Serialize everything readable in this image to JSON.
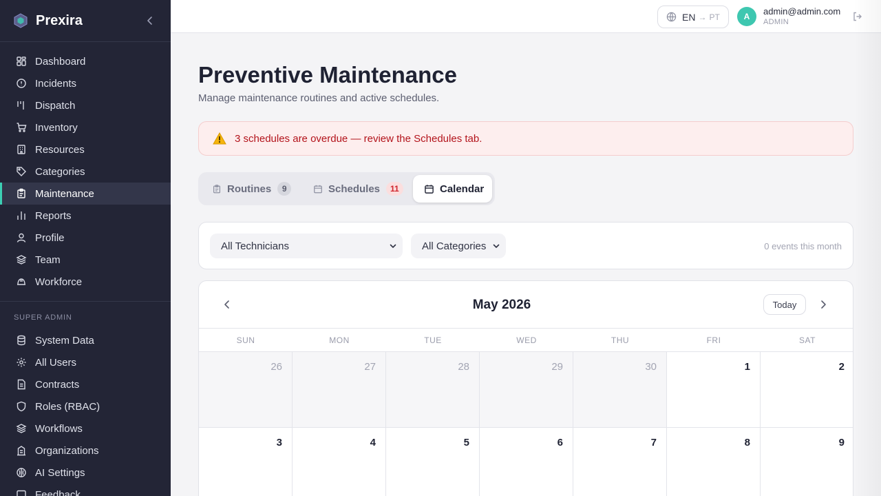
{
  "brand": {
    "name": "Prexira"
  },
  "sidebar": {
    "items": [
      {
        "label": "Dashboard",
        "icon": "dashboard-icon",
        "active": false
      },
      {
        "label": "Incidents",
        "icon": "alert-circle-icon",
        "active": false
      },
      {
        "label": "Dispatch",
        "icon": "dispatch-icon",
        "active": false
      },
      {
        "label": "Inventory",
        "icon": "cart-icon",
        "active": false
      },
      {
        "label": "Resources",
        "icon": "building-icon",
        "active": false
      },
      {
        "label": "Categories",
        "icon": "tag-icon",
        "active": false
      },
      {
        "label": "Maintenance",
        "icon": "clipboard-icon",
        "active": true
      },
      {
        "label": "Reports",
        "icon": "bar-chart-icon",
        "active": false
      },
      {
        "label": "Profile",
        "icon": "user-icon",
        "active": false
      },
      {
        "label": "Team",
        "icon": "layers-icon",
        "active": false
      },
      {
        "label": "Workforce",
        "icon": "hard-hat-icon",
        "active": false
      }
    ],
    "admin_section_label": "SUPER ADMIN",
    "admin_items": [
      {
        "label": "System Data",
        "icon": "database-icon"
      },
      {
        "label": "All Users",
        "icon": "gear-icon"
      },
      {
        "label": "Contracts",
        "icon": "document-icon"
      },
      {
        "label": "Roles (RBAC)",
        "icon": "shield-icon"
      },
      {
        "label": "Workflows",
        "icon": "layers-icon"
      },
      {
        "label": "Organizations",
        "icon": "building-icon"
      },
      {
        "label": "AI Settings",
        "icon": "brain-icon"
      },
      {
        "label": "Feedback",
        "icon": "message-icon"
      }
    ]
  },
  "topbar": {
    "lang_current": "EN",
    "lang_arrow": "→",
    "lang_other": "PT",
    "avatar_letter": "A",
    "user_email": "admin@admin.com",
    "user_role": "ADMIN"
  },
  "page": {
    "title": "Preventive Maintenance",
    "subtitle": "Manage maintenance routines and active schedules.",
    "alert": "3 schedules are overdue — review the Schedules tab."
  },
  "tabs": {
    "routines_label": "Routines",
    "routines_count": "9",
    "schedules_label": "Schedules",
    "schedules_count": "11",
    "calendar_label": "Calendar",
    "active": "Calendar"
  },
  "filters": {
    "technicians": "All Technicians",
    "categories": "All Categories",
    "events_text": "0 events this month"
  },
  "calendar": {
    "month_label": "May 2026",
    "today_label": "Today",
    "weekdays": [
      "SUN",
      "MON",
      "TUE",
      "WED",
      "THU",
      "FRI",
      "SAT"
    ],
    "weeks": [
      [
        {
          "day": "26",
          "other": true
        },
        {
          "day": "27",
          "other": true
        },
        {
          "day": "28",
          "other": true
        },
        {
          "day": "29",
          "other": true
        },
        {
          "day": "30",
          "other": true
        },
        {
          "day": "1",
          "other": false
        },
        {
          "day": "2",
          "other": false
        }
      ],
      [
        {
          "day": "3",
          "other": false
        },
        {
          "day": "4",
          "other": false
        },
        {
          "day": "5",
          "other": false
        },
        {
          "day": "6",
          "other": false
        },
        {
          "day": "7",
          "other": false
        },
        {
          "day": "8",
          "other": false
        },
        {
          "day": "9",
          "other": false
        }
      ]
    ]
  },
  "colors": {
    "sidebar_bg": "#232536",
    "accent": "#3ccfb4",
    "alert_text": "#b3131b",
    "alert_bg": "#fdeeee"
  }
}
